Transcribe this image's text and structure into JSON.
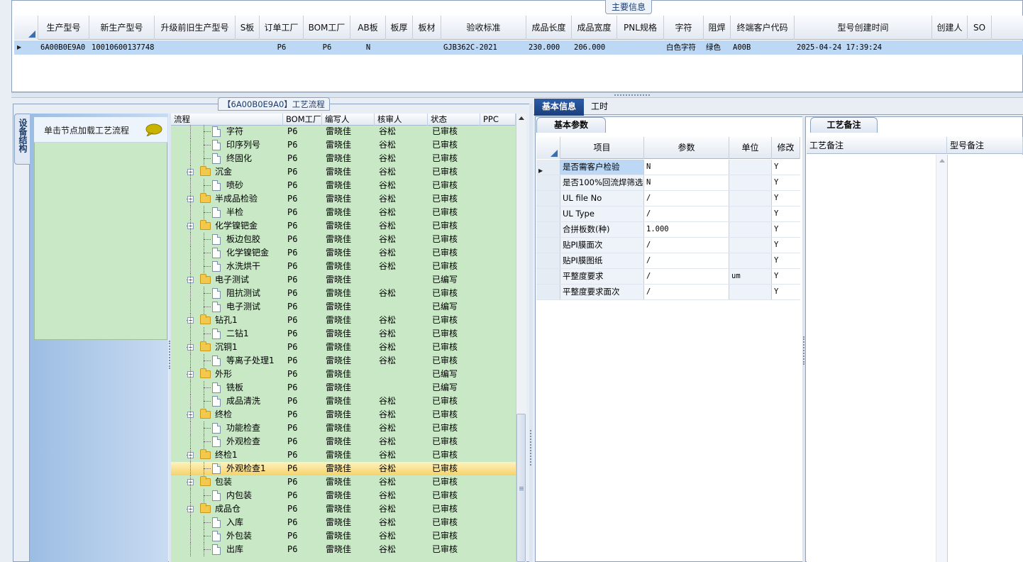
{
  "top": {
    "caption": "主要信息",
    "columns": [
      "生产型号",
      "新生产型号",
      "升级前旧生产型号",
      "S板",
      "订单工厂",
      "BOM工厂",
      "AB板",
      "板厚",
      "板材",
      "验收标准",
      "成品长度",
      "成品宽度",
      "PNL规格",
      "字符",
      "阻焊",
      "终端客户代码",
      "型号创建时间",
      "创建人",
      "SO"
    ],
    "row": [
      "6A00B0E9A0",
      "10010600137748",
      "",
      "",
      "P6",
      "P6",
      "N",
      "",
      "",
      "GJB362C-2021",
      "230.000",
      "206.000",
      "",
      "白色字符",
      "绿色",
      "A00B",
      "2025-04-24 17:39:24",
      "",
      ""
    ]
  },
  "flow": {
    "caption": "【6A00B0E9A0】工艺流程",
    "side_tab": "设备结构",
    "node_hint": "单击节点加载工艺流程",
    "columns": [
      "流程",
      "BOM工厂",
      "编写人",
      "核审人",
      "状态",
      "PPC"
    ],
    "rows": [
      {
        "name": "字符",
        "level": 2,
        "bom": "P6",
        "writer": "雷晓佳",
        "checker": "谷松",
        "status": "已审核"
      },
      {
        "name": "印序列号",
        "level": 2,
        "bom": "P6",
        "writer": "雷晓佳",
        "checker": "谷松",
        "status": "已审核"
      },
      {
        "name": "终固化",
        "level": 2,
        "bom": "P6",
        "writer": "雷晓佳",
        "checker": "谷松",
        "status": "已审核"
      },
      {
        "name": "沉金",
        "level": 1,
        "bom": "P6",
        "writer": "雷晓佳",
        "checker": "谷松",
        "status": "已审核"
      },
      {
        "name": "喷砂",
        "level": 2,
        "bom": "P6",
        "writer": "雷晓佳",
        "checker": "谷松",
        "status": "已审核"
      },
      {
        "name": "半成品检验",
        "level": 1,
        "bom": "P6",
        "writer": "雷晓佳",
        "checker": "谷松",
        "status": "已审核"
      },
      {
        "name": "半检",
        "level": 2,
        "bom": "P6",
        "writer": "雷晓佳",
        "checker": "谷松",
        "status": "已审核"
      },
      {
        "name": "化学镍钯金",
        "level": 1,
        "bom": "P6",
        "writer": "雷晓佳",
        "checker": "谷松",
        "status": "已审核"
      },
      {
        "name": "板边包胶",
        "level": 2,
        "bom": "P6",
        "writer": "雷晓佳",
        "checker": "谷松",
        "status": "已审核"
      },
      {
        "name": "化学镍钯金",
        "level": 2,
        "bom": "P6",
        "writer": "雷晓佳",
        "checker": "谷松",
        "status": "已审核"
      },
      {
        "name": "水洗烘干",
        "level": 2,
        "bom": "P6",
        "writer": "雷晓佳",
        "checker": "谷松",
        "status": "已审核"
      },
      {
        "name": "电子测试",
        "level": 1,
        "bom": "P6",
        "writer": "雷晓佳",
        "checker": "",
        "status": "已编写"
      },
      {
        "name": "阻抗测试",
        "level": 2,
        "bom": "P6",
        "writer": "雷晓佳",
        "checker": "谷松",
        "status": "已审核"
      },
      {
        "name": "电子测试",
        "level": 2,
        "bom": "P6",
        "writer": "雷晓佳",
        "checker": "",
        "status": "已编写"
      },
      {
        "name": "钻孔1",
        "level": 1,
        "bom": "P6",
        "writer": "雷晓佳",
        "checker": "谷松",
        "status": "已审核"
      },
      {
        "name": "二钻1",
        "level": 2,
        "bom": "P6",
        "writer": "雷晓佳",
        "checker": "谷松",
        "status": "已审核"
      },
      {
        "name": "沉铜1",
        "level": 1,
        "bom": "P6",
        "writer": "雷晓佳",
        "checker": "谷松",
        "status": "已审核"
      },
      {
        "name": "等离子处理1",
        "level": 2,
        "bom": "P6",
        "writer": "雷晓佳",
        "checker": "谷松",
        "status": "已审核"
      },
      {
        "name": "外形",
        "level": 1,
        "bom": "P6",
        "writer": "雷晓佳",
        "checker": "",
        "status": "已编写"
      },
      {
        "name": "铣板",
        "level": 2,
        "bom": "P6",
        "writer": "雷晓佳",
        "checker": "",
        "status": "已编写"
      },
      {
        "name": "成品清洗",
        "level": 2,
        "bom": "P6",
        "writer": "雷晓佳",
        "checker": "谷松",
        "status": "已审核"
      },
      {
        "name": "终检",
        "level": 1,
        "bom": "P6",
        "writer": "雷晓佳",
        "checker": "谷松",
        "status": "已审核"
      },
      {
        "name": "功能检查",
        "level": 2,
        "bom": "P6",
        "writer": "雷晓佳",
        "checker": "谷松",
        "status": "已审核"
      },
      {
        "name": "外观检查",
        "level": 2,
        "bom": "P6",
        "writer": "雷晓佳",
        "checker": "谷松",
        "status": "已审核"
      },
      {
        "name": "终检1",
        "level": 1,
        "bom": "P6",
        "writer": "雷晓佳",
        "checker": "谷松",
        "status": "已审核"
      },
      {
        "name": "外观检查1",
        "level": 2,
        "bom": "P6",
        "writer": "雷晓佳",
        "checker": "谷松",
        "status": "已审核",
        "selected": true
      },
      {
        "name": "包装",
        "level": 1,
        "bom": "P6",
        "writer": "雷晓佳",
        "checker": "谷松",
        "status": "已审核"
      },
      {
        "name": "内包装",
        "level": 2,
        "bom": "P6",
        "writer": "雷晓佳",
        "checker": "谷松",
        "status": "已审核"
      },
      {
        "name": "成品仓",
        "level": 1,
        "bom": "P6",
        "writer": "雷晓佳",
        "checker": "谷松",
        "status": "已审核"
      },
      {
        "name": "入库",
        "level": 2,
        "bom": "P6",
        "writer": "雷晓佳",
        "checker": "谷松",
        "status": "已审核"
      },
      {
        "name": "外包装",
        "level": 2,
        "bom": "P6",
        "writer": "雷晓佳",
        "checker": "谷松",
        "status": "已审核"
      },
      {
        "name": "出库",
        "level": 2,
        "bom": "P6",
        "writer": "雷晓佳",
        "checker": "谷松",
        "status": "已审核"
      }
    ]
  },
  "right": {
    "tabs": [
      "基本信息",
      "工时"
    ],
    "params_tab": "基本参数",
    "params_columns": [
      "项目",
      "参数",
      "单位",
      "修改"
    ],
    "params": [
      {
        "item": "是否需客户检验",
        "value": "N",
        "unit": "",
        "mod": "Y"
      },
      {
        "item": "是否100%回流焊筛选",
        "value": "N",
        "unit": "",
        "mod": "Y"
      },
      {
        "item": "UL file No",
        "value": "/",
        "unit": "",
        "mod": "Y"
      },
      {
        "item": "UL Type",
        "value": "/",
        "unit": "",
        "mod": "Y"
      },
      {
        "item": "合拼板数(种)",
        "value": "1.000",
        "unit": "",
        "mod": "Y"
      },
      {
        "item": "贴PI膜面次",
        "value": "/",
        "unit": "",
        "mod": "Y"
      },
      {
        "item": "贴PI膜图纸",
        "value": "/",
        "unit": "",
        "mod": "Y"
      },
      {
        "item": "平整度要求",
        "value": "/",
        "unit": "um",
        "mod": "Y"
      },
      {
        "item": "平整度要求面次",
        "value": "/",
        "unit": "",
        "mod": "Y"
      }
    ],
    "notes_tab": "工艺备注",
    "notes_columns": [
      "工艺备注",
      "型号备注"
    ]
  },
  "colors": {
    "selection_row": "#bcd8f5",
    "tree_bg": "#c8e8c6",
    "tab_active": "#1b3f7a",
    "selected_node": "#f6d36a"
  }
}
